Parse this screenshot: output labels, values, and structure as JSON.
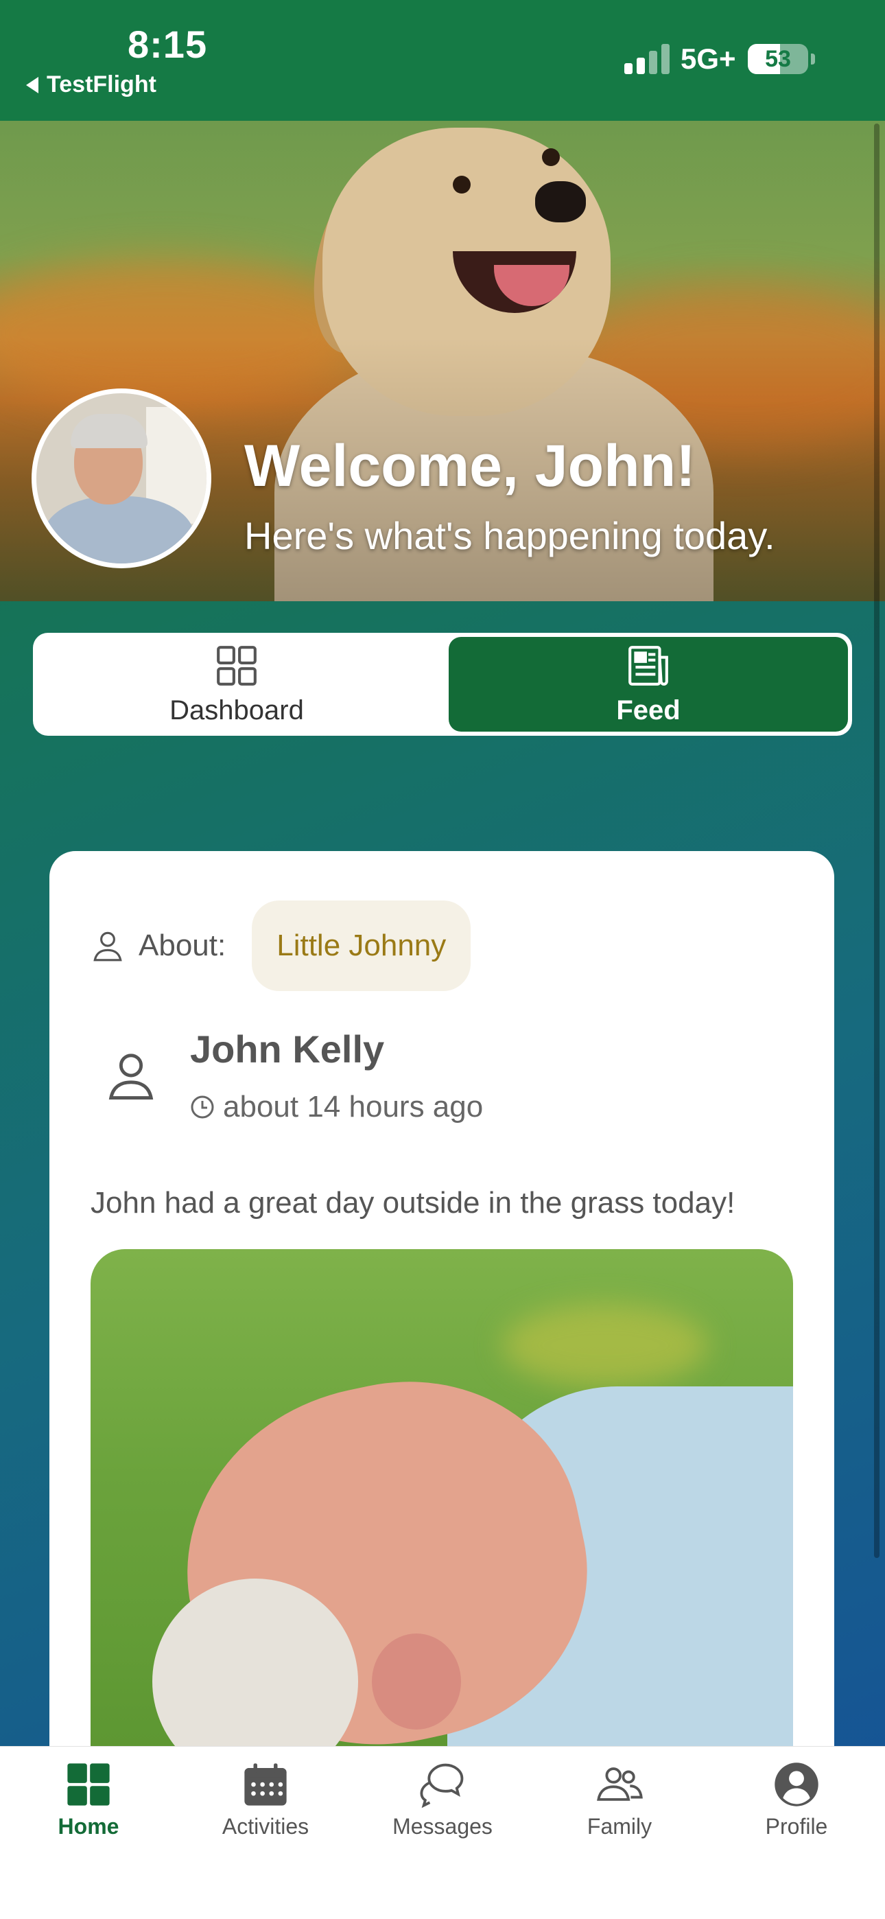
{
  "status_bar": {
    "time": "8:15",
    "back_app": "TestFlight",
    "network": "5G+",
    "battery": "53",
    "battery_level": 0.53
  },
  "header": {
    "title": "Welcome, John!",
    "subtitle": "Here's what's happening today."
  },
  "segments": [
    {
      "label": "Dashboard",
      "icon": "grid-icon",
      "active": false
    },
    {
      "label": "Feed",
      "icon": "newspaper-icon",
      "active": true
    }
  ],
  "post": {
    "about_label": "About:",
    "about_chip": "Little Johnny",
    "author": "John Kelly",
    "time_ago": "about 14 hours ago",
    "text": "John had a great day outside in the grass today!"
  },
  "tabs": [
    {
      "label": "Home",
      "icon": "home-grid-icon",
      "active": true
    },
    {
      "label": "Activities",
      "icon": "calendar-icon",
      "active": false
    },
    {
      "label": "Messages",
      "icon": "chat-bubbles-icon",
      "active": false
    },
    {
      "label": "Family",
      "icon": "people-icon",
      "active": false
    },
    {
      "label": "Profile",
      "icon": "user-circle-icon",
      "active": false
    }
  ],
  "colors": {
    "brand_green": "#136b37",
    "chip_bg": "#f5f1e6",
    "chip_text": "#9a7a16"
  }
}
